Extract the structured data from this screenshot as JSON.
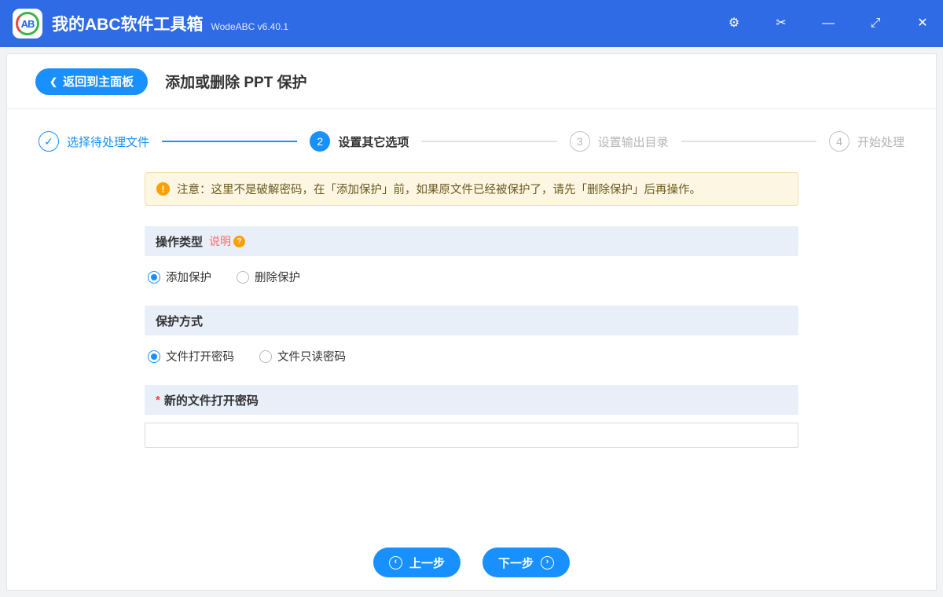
{
  "titlebar": {
    "logo": "AB",
    "title": "我的ABC软件工具箱",
    "version": "WodeABC v6.40.1",
    "icons": [
      {
        "name": "settings",
        "glyph": "⚙"
      },
      {
        "name": "scissors",
        "glyph": "✂"
      },
      {
        "name": "minimize",
        "glyph": "—"
      },
      {
        "name": "resize",
        "glyph": "⤢"
      },
      {
        "name": "close",
        "glyph": "✕"
      }
    ]
  },
  "header": {
    "back_chevron": "❮",
    "back": "返回到主面板",
    "title": "添加或删除 PPT 保护"
  },
  "steps": [
    {
      "num": "✓",
      "label": "选择待处理文件",
      "state": "done"
    },
    {
      "num": "2",
      "label": "设置其它选项",
      "state": "active"
    },
    {
      "num": "3",
      "label": "设置输出目录",
      "state": "pending"
    },
    {
      "num": "4",
      "label": "开始处理",
      "state": "pending"
    }
  ],
  "notice": {
    "icon": "!",
    "text": "注意：这里不是破解密码，在「添加保护」前，如果原文件已经被保护了，请先「删除保护」后再操作。"
  },
  "operation": {
    "title": "操作类型",
    "help": "说明",
    "help_icon": "?",
    "options": [
      {
        "label": "添加保护",
        "checked": true
      },
      {
        "label": "删除保护",
        "checked": false
      }
    ]
  },
  "protection": {
    "title": "保护方式",
    "options": [
      {
        "label": "文件打开密码",
        "checked": true
      },
      {
        "label": "文件只读密码",
        "checked": false
      }
    ]
  },
  "password": {
    "required": "*",
    "title": "新的文件打开密码",
    "value": ""
  },
  "footer": {
    "prev_icon": "‹",
    "prev": "上一步",
    "next": "下一步",
    "next_icon": "›"
  },
  "colors": {
    "titlebar": "#2e6be5",
    "accent": "#1890ff",
    "section_bg": "#e9eff9",
    "notice_bg": "#fdf6e3",
    "notice_border": "#f0dfae",
    "warn_orange": "#ff9f00",
    "link_red": "#f56c6c"
  }
}
